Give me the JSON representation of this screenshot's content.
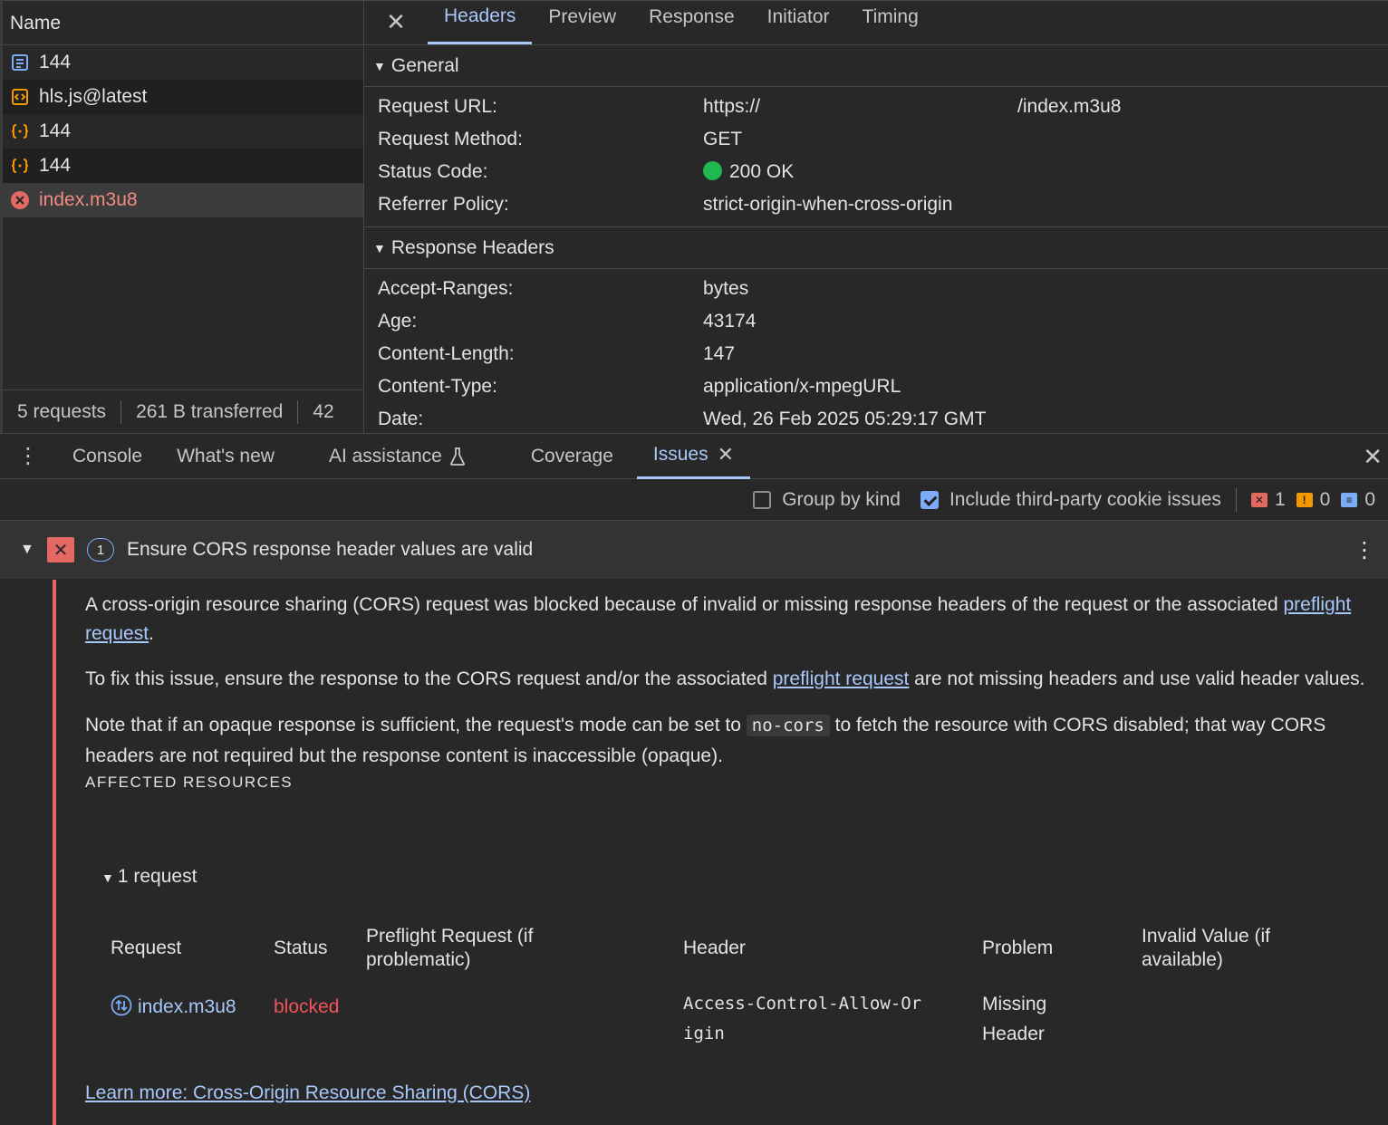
{
  "network": {
    "name_header": "Name",
    "requests": [
      {
        "label": "144",
        "icon": "document-icon",
        "icon_color": "#7cacf8",
        "style": ""
      },
      {
        "label": "hls.js@latest",
        "icon": "script-icon",
        "icon_color": "#f29900",
        "style": "alt"
      },
      {
        "label": "144",
        "icon": "fetch-icon",
        "icon_color": "#f29900",
        "style": ""
      },
      {
        "label": "144",
        "icon": "fetch-icon",
        "icon_color": "#f29900",
        "style": "alt"
      },
      {
        "label": "index.m3u8",
        "icon": "error-icon",
        "icon_color": "#e46962",
        "style": "sel"
      }
    ],
    "footer": {
      "requests": "5 requests",
      "transferred": "261 B transferred",
      "resources": "42"
    }
  },
  "detail": {
    "tabs": [
      "Headers",
      "Preview",
      "Response",
      "Initiator",
      "Timing"
    ],
    "active_tab": "Headers",
    "general": {
      "title": "General",
      "rows": [
        {
          "key": "Request URL:",
          "value": "https://",
          "value_tail": "/index.m3u8"
        },
        {
          "key": "Request Method:",
          "value": "GET"
        },
        {
          "key": "Status Code:",
          "value": "200 OK"
        },
        {
          "key": "Referrer Policy:",
          "value": "strict-origin-when-cross-origin"
        }
      ]
    },
    "response_headers": {
      "title": "Response Headers",
      "rows": [
        {
          "key": "Accept-Ranges:",
          "value": "bytes"
        },
        {
          "key": "Age:",
          "value": "43174"
        },
        {
          "key": "Content-Length:",
          "value": "147"
        },
        {
          "key": "Content-Type:",
          "value": "application/x-mpegURL"
        },
        {
          "key": "Date:",
          "value": "Wed, 26 Feb 2025 05:29:17 GMT"
        }
      ]
    }
  },
  "drawer": {
    "tabs": [
      "Console",
      "What's new",
      "AI assistance",
      "Coverage",
      "Issues"
    ],
    "active_tab": "Issues",
    "toolbar": {
      "group_by_kind": "Group by kind",
      "group_by_kind_checked": false,
      "include_third_party": "Include third-party cookie issues",
      "include_third_party_checked": true,
      "errors": "1",
      "warnings": "0",
      "infos": "0"
    },
    "issue": {
      "count": "1",
      "title": "Ensure CORS response header values are valid",
      "p1_a": "A cross-origin resource sharing (CORS) request was blocked because of invalid or missing response headers of the request or the associated ",
      "p1_link": "preflight request",
      "p1_b": ".",
      "p2_a": "To fix this issue, ensure the response to the CORS request and/or the associated ",
      "p2_link": "preflight request",
      "p2_b": " are not missing headers and use valid header values.",
      "p3_a": "Note that if an opaque response is sufficient, the request's mode can be set to ",
      "p3_code": "no-cors",
      "p3_b": " to fetch the resource with CORS disabled; that way CORS headers are not required but the response content is inaccessible (opaque).",
      "affected_label": "AFFECTED RESOURCES",
      "request_count": "1 request",
      "columns": [
        "Request",
        "Status",
        "Preflight Request (if problematic)",
        "Header",
        "Problem",
        "Invalid Value (if available)"
      ],
      "row": {
        "request": "index.m3u8",
        "status": "blocked",
        "preflight": "",
        "header": "Access-Control-Allow-Origin",
        "problem": "Missing Header",
        "invalid_value": ""
      },
      "learn_more": "Learn more: Cross-Origin Resource Sharing (CORS)"
    }
  },
  "colors": {
    "accent": "#a8c7fa",
    "error": "#e46962",
    "ok": "#1fb950",
    "warning": "#f29900"
  }
}
